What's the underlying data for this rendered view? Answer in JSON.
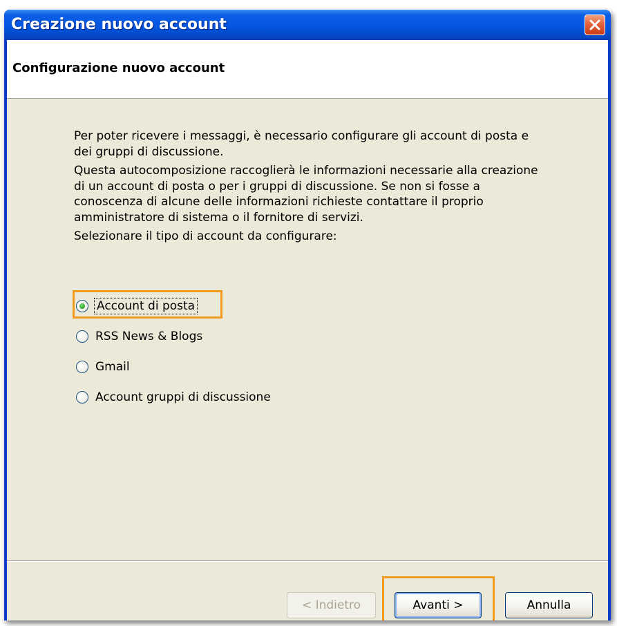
{
  "window": {
    "title": "Creazione nuovo account"
  },
  "header": {
    "title": "Configurazione nuovo account"
  },
  "body": {
    "paragraph_1": "Per poter ricevere i messaggi, è necessario configurare gli account di posta e dei gruppi di discussione.",
    "paragraph_2": "Questa autocomposizione raccoglierà le informazioni necessarie alla creazione di un account di posta o per i gruppi di discussione. Se non si fosse a conoscenza di alcune delle informazioni richieste contattare il proprio amministratore di sistema o il fornitore di servizi.",
    "prompt": "Selezionare il tipo di account da configurare:"
  },
  "account_types": [
    {
      "label": "Account di posta",
      "selected": true
    },
    {
      "label": "RSS News & Blogs",
      "selected": false
    },
    {
      "label": "Gmail",
      "selected": false
    },
    {
      "label": "Account gruppi di discussione",
      "selected": false
    }
  ],
  "buttons": {
    "back": "< Indietro",
    "next": "Avanti >",
    "cancel": "Annulla"
  },
  "colors": {
    "titlebar": "#0556e0",
    "dialog_face": "#ece9d8",
    "highlight": "#f29a1c",
    "radio_selected": "#27a323"
  },
  "icons": {
    "close": "close-icon"
  }
}
